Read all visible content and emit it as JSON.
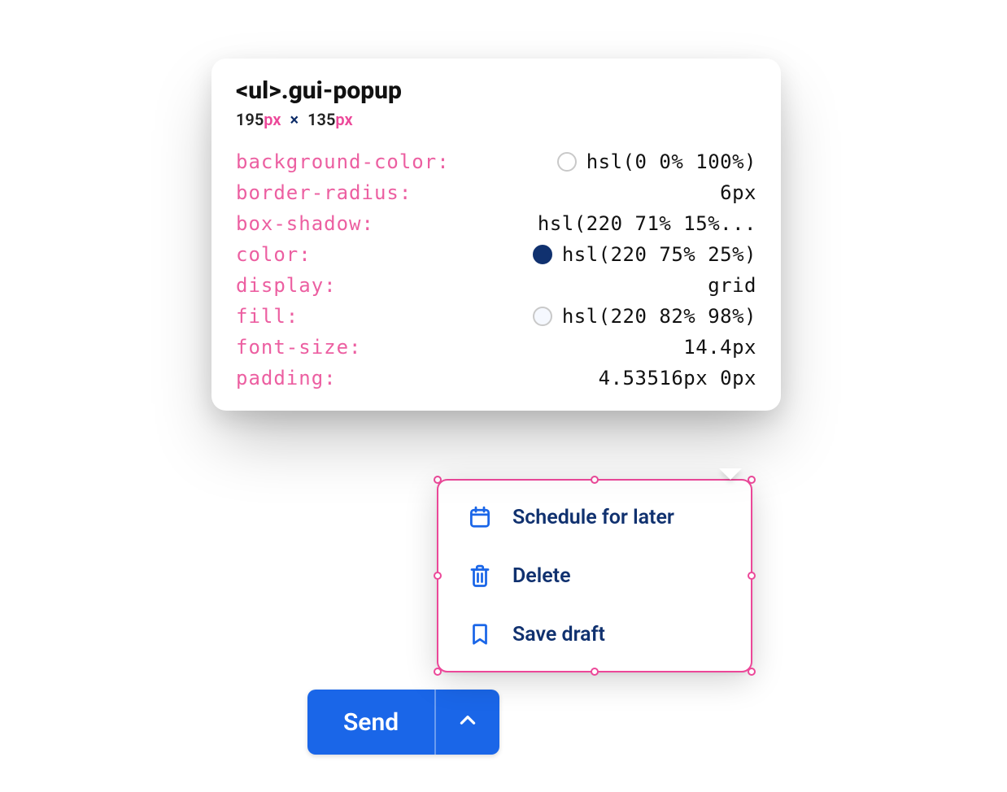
{
  "colors": {
    "accent_blue": "#1a66e8",
    "text_navy": "#10316f",
    "selection_pink": "#ec4899",
    "prop_pink": "#ec5fa1"
  },
  "send_button": {
    "main_label": "Send"
  },
  "popup": {
    "selector_tag": "<ul>",
    "selector_class": ".gui-popup",
    "items": [
      {
        "icon": "calendar-icon",
        "label": "Schedule for later"
      },
      {
        "icon": "trash-icon",
        "label": "Delete"
      },
      {
        "icon": "bookmark-icon",
        "label": "Save draft"
      }
    ]
  },
  "devtools": {
    "dimensions": {
      "width_num": "195",
      "width_unit": "px",
      "times": "×",
      "height_num": "135",
      "height_unit": "px"
    },
    "styles": [
      {
        "prop": "background-color",
        "value": "hsl(0 0% 100%)",
        "swatch": "#ffffff"
      },
      {
        "prop": "border-radius",
        "value": "6px"
      },
      {
        "prop": "box-shadow",
        "value": "hsl(220 71% 15%..."
      },
      {
        "prop": "color",
        "value": "hsl(220 75% 25%)",
        "swatch": "#10316f"
      },
      {
        "prop": "display",
        "value": "grid"
      },
      {
        "prop": "fill",
        "value": "hsl(220 82% 98%)",
        "swatch": "#f5f8fe"
      },
      {
        "prop": "font-size",
        "value": "14.4px"
      },
      {
        "prop": "padding",
        "value": "4.53516px 0px"
      }
    ]
  }
}
